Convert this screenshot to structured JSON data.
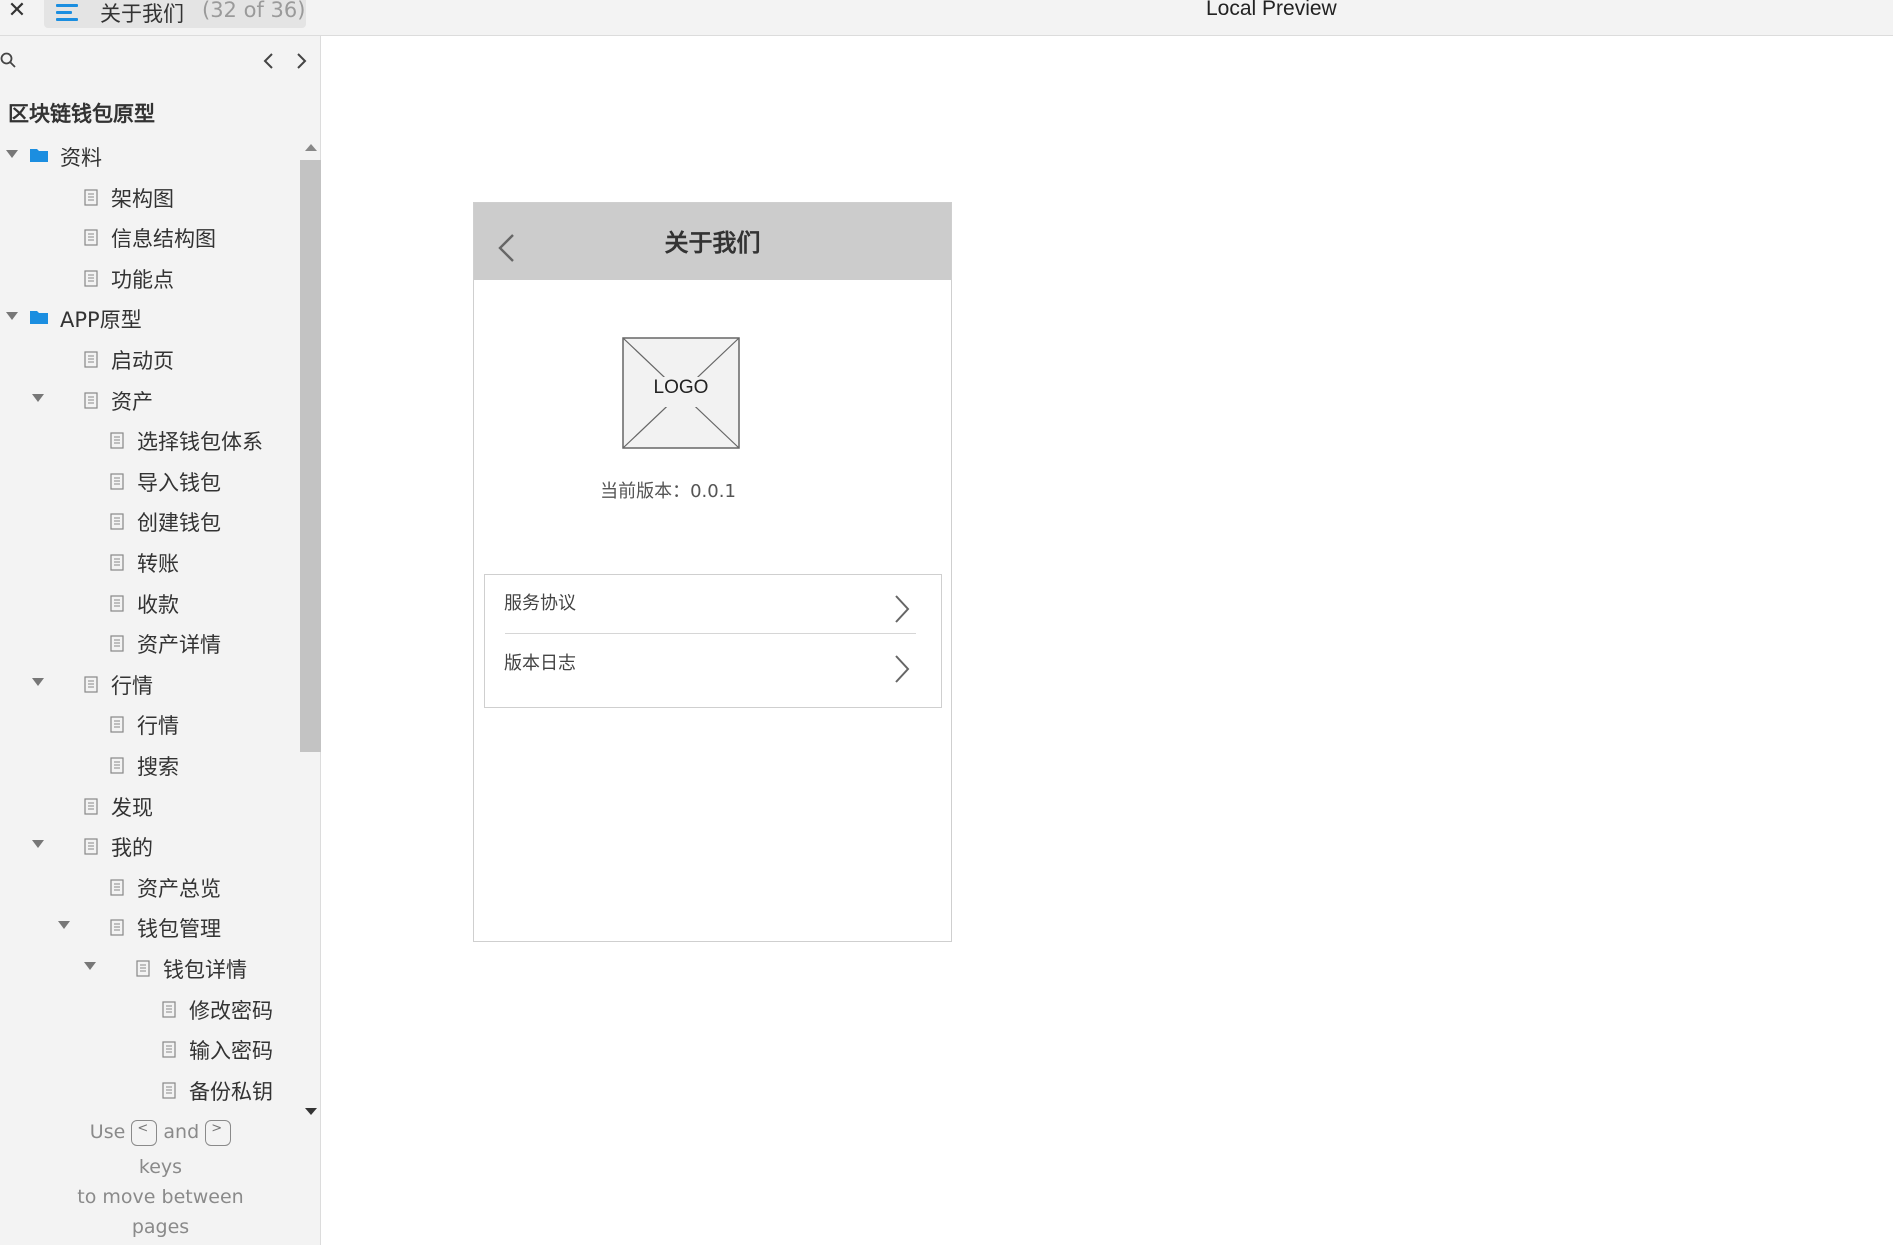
{
  "topbar": {
    "close_icon": "close-icon",
    "page_title": "关于我们",
    "page_count": "(32 of 36)",
    "preview_title": "Local Preview"
  },
  "sidebar": {
    "project_title": "区块链钱包原型",
    "tree": [
      {
        "label": "资料",
        "level": 0,
        "kind": "folder",
        "expanded": true
      },
      {
        "label": "架构图",
        "level": 1,
        "kind": "page"
      },
      {
        "label": "信息结构图",
        "level": 1,
        "kind": "page"
      },
      {
        "label": "功能点",
        "level": 1,
        "kind": "page"
      },
      {
        "label": "APP原型",
        "level": 0,
        "kind": "folder",
        "expanded": true
      },
      {
        "label": "启动页",
        "level": 1,
        "kind": "page"
      },
      {
        "label": "资产",
        "level": 1,
        "kind": "page",
        "expanded": true
      },
      {
        "label": "选择钱包体系",
        "level": 2,
        "kind": "page"
      },
      {
        "label": "导入钱包",
        "level": 2,
        "kind": "page"
      },
      {
        "label": "创建钱包",
        "level": 2,
        "kind": "page"
      },
      {
        "label": "转账",
        "level": 2,
        "kind": "page"
      },
      {
        "label": "收款",
        "level": 2,
        "kind": "page"
      },
      {
        "label": "资产详情",
        "level": 2,
        "kind": "page"
      },
      {
        "label": "行情",
        "level": 1,
        "kind": "page",
        "expanded": true
      },
      {
        "label": "行情",
        "level": 2,
        "kind": "page"
      },
      {
        "label": "搜索",
        "level": 2,
        "kind": "page"
      },
      {
        "label": "发现",
        "level": 1,
        "kind": "page"
      },
      {
        "label": "我的",
        "level": 1,
        "kind": "page",
        "expanded": true
      },
      {
        "label": "资产总览",
        "level": 2,
        "kind": "page"
      },
      {
        "label": "钱包管理",
        "level": 2,
        "kind": "page",
        "expanded": true
      },
      {
        "label": "钱包详情",
        "level": 3,
        "kind": "page",
        "expanded": true
      },
      {
        "label": "修改密码",
        "level": 4,
        "kind": "page"
      },
      {
        "label": "输入密码",
        "level": 4,
        "kind": "page"
      },
      {
        "label": "备份私钥",
        "level": 4,
        "kind": "page"
      }
    ],
    "hint": {
      "use": "Use",
      "and": "and",
      "keys": "keys",
      "line3": "to move between",
      "line4": "pages",
      "key_prev": "<",
      "key_next": ">"
    }
  },
  "phone": {
    "title": "关于我们",
    "logo_text": "LOGO",
    "version_text": "当前版本：0.0.1",
    "menu": [
      {
        "label": "服务协议"
      },
      {
        "label": "版本日志"
      }
    ]
  }
}
